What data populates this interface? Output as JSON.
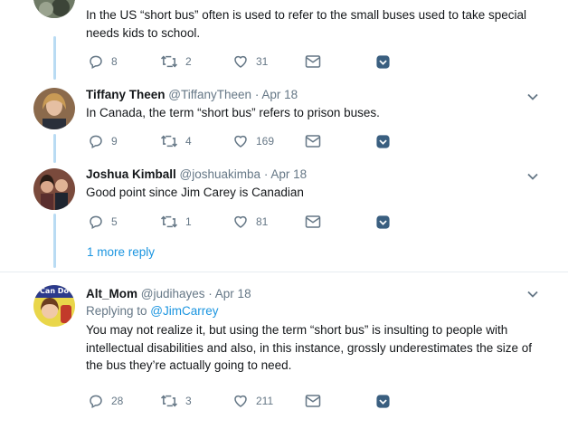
{
  "tweets": [
    {
      "text": "In the US “short bus” often is used to refer to the small buses used to take special needs kids to school.",
      "replies": "8",
      "retweets": "2",
      "likes": "31"
    },
    {
      "name": "Tiffany Theen",
      "handle": "@TiffanyTheen",
      "dot": "·",
      "date": "Apr 18",
      "text": "In Canada,  the term “short bus” refers to prison buses.",
      "replies": "9",
      "retweets": "4",
      "likes": "169"
    },
    {
      "name": "Joshua Kimball",
      "handle": "@joshuakimba",
      "dot": "·",
      "date": "Apr 18",
      "text": "Good point since Jim Carey is Canadian",
      "replies": "5",
      "retweets": "1",
      "likes": "81"
    },
    {
      "name": "Alt_Mom",
      "handle": "@judihayes",
      "dot": "·",
      "date": "Apr 18",
      "replying_prefix": "Replying to ",
      "replying_to": "@JimCarrey",
      "text": "You may not realize it, but using the term “short bus” is insulting to people with intellectual disabilities and also, in this instance, grossly underestimates the size of the bus they’re actually going to need.",
      "replies": "28",
      "retweets": "3",
      "likes": "211",
      "avatar_badge": "Can Do"
    }
  ],
  "more_reply": "1 more reply",
  "colors": {
    "accent": "#1b95e0",
    "muted": "#657786",
    "thread": "#b9dbf3",
    "dm": "#3a5f80"
  },
  "icons": [
    "reply-icon",
    "retweet-icon",
    "like-icon",
    "message-icon",
    "share-icon",
    "chevron-down-icon"
  ]
}
